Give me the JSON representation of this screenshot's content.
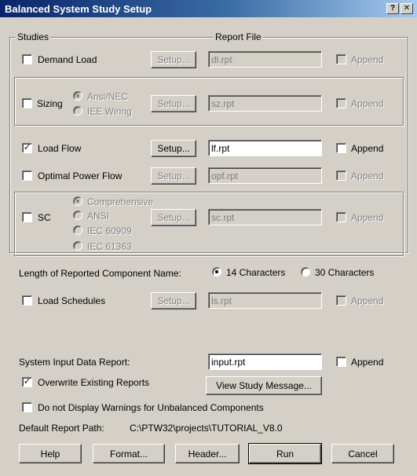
{
  "window": {
    "title": "Balanced System Study Setup",
    "help_button": "?",
    "close_button": "✕"
  },
  "studies_group": {
    "legend": "Studies",
    "report_file_legend": "Report File"
  },
  "studies": {
    "demand_load": {
      "label": "Demand Load",
      "checked": false,
      "setup": "Setup...",
      "file": "dl.rpt",
      "append": "Append"
    },
    "sizing": {
      "label": "Sizing",
      "checked": false,
      "options": [
        "Ansi/NEC",
        "IEE Wiring"
      ],
      "selected": "Ansi/NEC",
      "setup": "Setup...",
      "file": "sz.rpt",
      "append": "Append"
    },
    "load_flow": {
      "label": "Load Flow",
      "checked": true,
      "setup": "Setup...",
      "file": "lf.rpt",
      "append": "Append"
    },
    "optimal_power_flow": {
      "label": "Optimal Power Flow",
      "checked": false,
      "setup": "Setup...",
      "file": "opf.rpt",
      "append": "Append"
    },
    "sc": {
      "label": "SC",
      "checked": false,
      "options": [
        "Comprehensive",
        "ANSI",
        "IEC 60909",
        "IEC 61363"
      ],
      "selected": "Comprehensive",
      "setup": "Setup...",
      "file": "sc.rpt",
      "append": "Append"
    }
  },
  "component_name": {
    "label": "Length of Reported Component Name:",
    "options": [
      "14 Characters",
      "30 Characters"
    ],
    "selected": "14 Characters"
  },
  "load_schedules": {
    "label": "Load Schedules",
    "checked": false,
    "setup": "Setup...",
    "file": "ls.rpt",
    "append": "Append"
  },
  "system_input": {
    "label": "System Input Data Report:",
    "file": "input.rpt",
    "append": "Append"
  },
  "overwrite": {
    "label": "Overwrite Existing Reports",
    "checked": true
  },
  "view_study_message": "View Study Message...",
  "no_warnings": {
    "label": "Do not Display Warnings for Unbalanced Components",
    "checked": false
  },
  "default_path": {
    "label": "Default Report Path:",
    "value": "C:\\PTW32\\projects\\TUTORIAL_V8.0"
  },
  "buttons": {
    "help": "Help",
    "format": "Format...",
    "header": "Header...",
    "run": "Run",
    "cancel": "Cancel"
  }
}
